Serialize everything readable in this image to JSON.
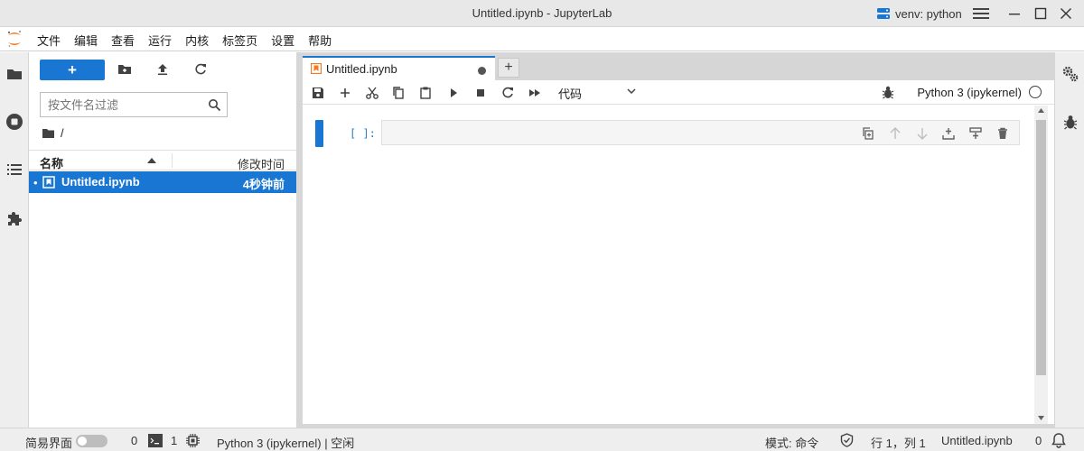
{
  "window": {
    "title": "Untitled.ipynb - JupyterLab",
    "env_label": "venv: python"
  },
  "menu": {
    "items": [
      "文件",
      "编辑",
      "查看",
      "运行",
      "内核",
      "标签页",
      "设置",
      "帮助"
    ]
  },
  "filebrowser": {
    "new_label": "+",
    "filter_placeholder": "按文件名过滤",
    "breadcrumb": "/",
    "col_name": "名称",
    "col_modified": "修改时间",
    "files": [
      {
        "dot": "•",
        "name": "Untitled.ipynb",
        "modified": "4秒钟前"
      }
    ]
  },
  "notebook": {
    "tab_label": "Untitled.ipynb",
    "add_tab": "+",
    "cell_type": "代码",
    "kernel_name": "Python 3 (ipykernel)",
    "cell_prompt": "[ ]:"
  },
  "status": {
    "simple_mode": "简易界面",
    "terminals_count": "0",
    "kernels_count": "1",
    "kernel_status": "Python 3 (ipykernel) | 空闲",
    "mode": "模式: 命令",
    "position": "行 1，列 1",
    "filename": "Untitled.ipynb",
    "notifications_count": "0"
  },
  "colors": {
    "accent": "#1976d2",
    "jupyter_orange": "#f37726",
    "prompt": "#307fc1"
  }
}
